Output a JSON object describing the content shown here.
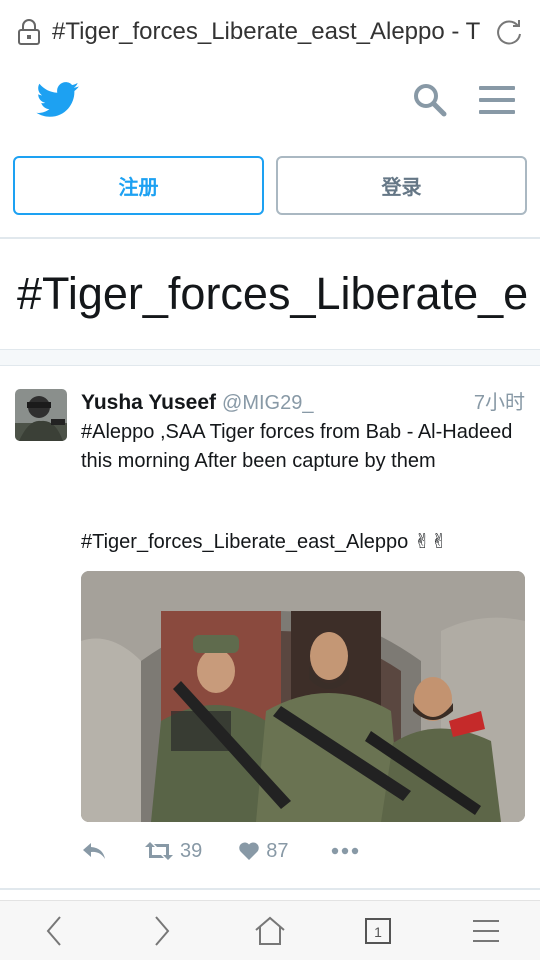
{
  "browser": {
    "url": "#Tiger_forces_Liberate_east_Aleppo - T",
    "lock_icon": "lock-icon",
    "reload_icon": "reload-icon",
    "tab_count": "1"
  },
  "nav": {
    "logo_icon": "twitter-bird-icon",
    "search_icon": "search-icon",
    "menu_icon": "hamburger-menu-icon"
  },
  "auth": {
    "signup_label": "注册",
    "login_label": "登录"
  },
  "page": {
    "title": "#Tiger_forces_Liberate_e"
  },
  "tweet": {
    "author_name": "Yusha Yuseef",
    "author_handle": "@MIG29_",
    "time": "7小时",
    "text": "#Aleppo ,SAA Tiger forces from Bab - Al-Hadeed this morning After been capture by them",
    "hashtags": "#Tiger_forces_Liberate_east_Aleppo ✌✌",
    "retweets": "39",
    "likes": "87"
  },
  "colors": {
    "brand": "#1da1f2",
    "muted": "#8899a6",
    "border": "#e1e8ed"
  }
}
